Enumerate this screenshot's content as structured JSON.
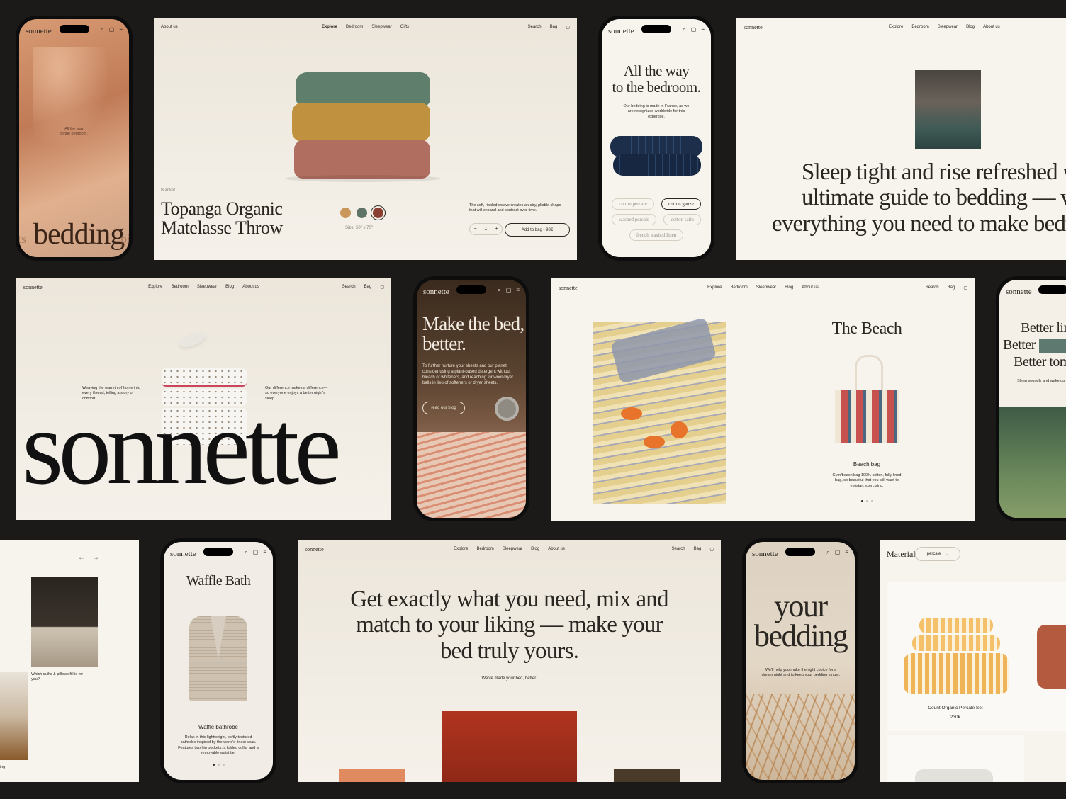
{
  "brand": "sonnette",
  "colors": {
    "bg": "#1b1a18",
    "cream": "#f4f0e8",
    "ink": "#2a2621"
  },
  "nav_a": {
    "about": "About us",
    "explore": "Explore",
    "bedroom": "Bedroom",
    "sleepwear": "Sleepwear",
    "gifts": "Gifts",
    "search": "Search",
    "bag": "Bag"
  },
  "nav_b": {
    "explore": "Explore",
    "bedroom": "Bedroom",
    "sleepwear": "Sleepwear",
    "blog": "Blog",
    "about": "About us",
    "search": "Search",
    "bag": "Bag"
  },
  "phone1": {
    "tagline_1": "All the way",
    "tagline_2": "to the bedroom.",
    "hero_word": "bedding",
    "left_frag": "ts",
    "right_frag": "pi"
  },
  "product": {
    "category": "Blanket",
    "title_1": "Topanga Organic",
    "title_2": "Matelasse Throw",
    "size": "Size: 50\" x 70\"",
    "description": "The soft, rippled weave creates an airy, pliable shape that will expand and contract over time.",
    "qty": "1",
    "minus": "−",
    "plus": "+",
    "add_label": "Add to bag - 98€",
    "swatches": [
      "#c9975a",
      "#5e7468",
      "#8a3f32"
    ]
  },
  "phone2": {
    "heading_1": "All the way",
    "heading_2": "to the bedroom.",
    "body": "Our bedding is made in France, as we are recognized worldwide for this expertise.",
    "chips": [
      "cotton percale",
      "cotton gauze",
      "washed percale",
      "cotton satin",
      "french washed linen"
    ]
  },
  "guide": {
    "line_1": "Sleep tight and rise refreshed with",
    "line_2": "ultimate guide to bedding — we've",
    "line_3": "everything you need to make bedtime"
  },
  "home": {
    "left_text": "Weaving the warmth of home into every thread, telling a story of comfort.",
    "right_text": "Our difference makes a difference—so everyone enjoys a better night's sleep.",
    "wordmark": "sonnette"
  },
  "blogphone": {
    "heading_1": "Make the bed,",
    "heading_2": "better.",
    "body": "To further nurture your sheets and our planet, consider using a plant-based detergent without bleach or whiteners, and reaching for wool dryer balls in lieu of softeners or dryer sheets.",
    "cta": "read our blog"
  },
  "beach": {
    "title": "The Beach",
    "product_name": "Beach bag",
    "description": "Gym/beach bag 100% cotton, fully lined bag, so beautiful that you will want to (re)start exercising."
  },
  "phone_right": {
    "line_1": "Better lin",
    "line_2": "Better",
    "line_3": "Better tomo",
    "sub": "Sleep soundly and wake up"
  },
  "quilts": {
    "prev": "←",
    "next": "→",
    "caption": "Which quilts & pillows fill is for you?",
    "bottom": "ing"
  },
  "waffle": {
    "title": "Waffle Bath",
    "product_name": "Waffle bathrobe",
    "description": "Relax in this lightweight, softly textured bathrobe inspired by the world's finest spas. Features two hip pockets, a folded collar and a removable waist tie."
  },
  "mix": {
    "line_1": "Get exactly what you need, mix and",
    "line_2": "match to your liking — make your",
    "line_3": "bed truly yours.",
    "sub": "We've made your bed, better."
  },
  "yourbed": {
    "word_1": "your",
    "word_2": "bedding",
    "body": "We'll help you make the right choice for a dream night and to keep your bedding longer."
  },
  "shop": {
    "filter_label": "Material",
    "filter_value": "percale",
    "product_name": "Count Organic Percale Set",
    "price": "230€"
  }
}
